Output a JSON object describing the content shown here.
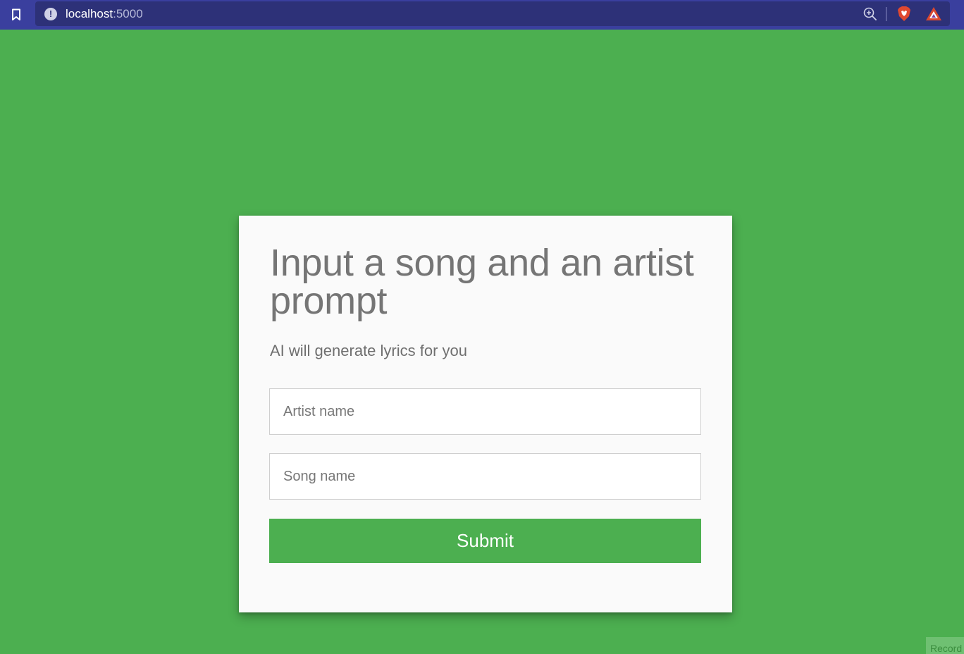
{
  "browser": {
    "url_host": "localhost",
    "url_port": ":5000",
    "info_icon": "!"
  },
  "form": {
    "title": "Input a song and an artist prompt",
    "subtitle": "AI will generate lyrics for you",
    "artist_placeholder": "Artist name",
    "song_placeholder": "Song name",
    "submit_label": "Submit"
  },
  "record_tab": {
    "label": "Record"
  },
  "colors": {
    "page_background": "#4caf50",
    "browser_bar": "#3a3f9e",
    "url_bar": "#2d3178",
    "card_background": "#fafafa",
    "submit_button": "#4caf50"
  },
  "icons": {
    "bookmark": "bookmark-icon",
    "info": "info-icon",
    "zoom": "zoom-in-icon",
    "brave": "brave-shields-icon",
    "rewards": "brave-rewards-icon"
  }
}
